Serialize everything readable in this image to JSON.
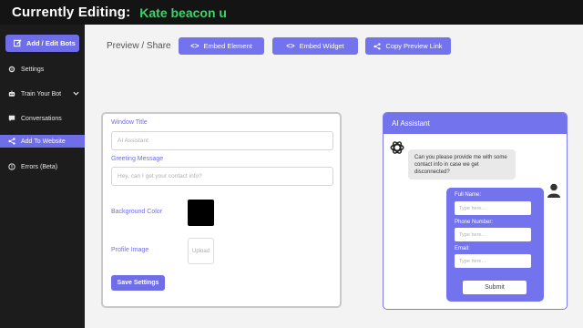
{
  "header": {
    "label": "Currently Editing:",
    "bot_name": "Kate  beacon u"
  },
  "sidebar": {
    "primary_button": "Add / Edit Bots",
    "items": [
      {
        "label": "Settings",
        "icon": "gear-icon"
      },
      {
        "label": "Train Your Bot",
        "icon": "robot-icon"
      },
      {
        "label": "Conversations",
        "icon": "chat-icon"
      },
      {
        "label": "Add To Website",
        "icon": "share-icon"
      },
      {
        "label": "Errors (Beta)",
        "icon": "alert-circle-icon"
      }
    ],
    "active_item": "Add To Website"
  },
  "toolbar": {
    "breadcrumb": "Preview / Share",
    "embed_element": "Embed Element",
    "embed_widget": "Embed Widget",
    "copy_link": "Copy Preview Link",
    "code_glyph": "<>"
  },
  "settings": {
    "window_title_label": "Window Title",
    "window_title_placeholder": "AI Assistant",
    "greeting_label": "Greeting Message",
    "greeting_placeholder": "Hey, can I get your contact info?",
    "bg_color_label": "Background Color",
    "bg_color_value": "#000000",
    "profile_image_label": "Profile Image",
    "upload_label": "Upload",
    "save_label": "Save Settings"
  },
  "chat": {
    "title": "AI Assistant",
    "bot_message": "Can you please provide me with some contact info in case we get disconnected?",
    "form": {
      "full_name_label": "Full Name:",
      "phone_label": "Phone Number:",
      "email_label": "Email:",
      "placeholder": "Type here...",
      "submit_label": "Submit"
    }
  },
  "colors": {
    "accent": "#7473ee",
    "topbar": "#141414",
    "sidebar": "#1c1c1c",
    "bot_name": "#3fd26b"
  }
}
